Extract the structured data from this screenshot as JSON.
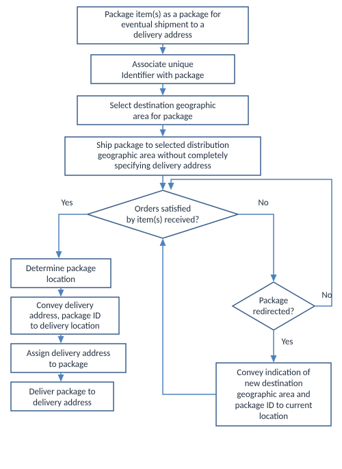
{
  "nodes": {
    "n1": {
      "l1": "Package item(s) as a package for",
      "l2": "eventual shipment to a",
      "l3": "delivery address"
    },
    "n2": {
      "l1": "Associate unique",
      "l2": "Identifier with package"
    },
    "n3": {
      "l1": "Select destination geographic",
      "l2": "area for package"
    },
    "n4": {
      "l1": "Ship package to selected distribution",
      "l2": "geographic area without completely",
      "l3": "specifying delivery address"
    },
    "d1": {
      "l1": "Orders satisfied",
      "l2": "by item(s) received?"
    },
    "d1_yes": "Yes",
    "d1_no": "No",
    "n5": {
      "l1": "Determine package",
      "l2": "location"
    },
    "n6": {
      "l1": "Convey delivery",
      "l2": "address, package ID",
      "l3": "to delivery location"
    },
    "n7": {
      "l1": "Assign delivery address",
      "l2": "to package"
    },
    "n8": {
      "l1": "Deliver package to",
      "l2": "delivery address"
    },
    "d2": {
      "l1": "Package",
      "l2": "redirected?"
    },
    "d2_yes": "Yes",
    "d2_no": "No",
    "n9": {
      "l1": "Convey indication of",
      "l2": "new destination",
      "l3": "geographic area and",
      "l4": "package ID to current",
      "l5": "location"
    }
  },
  "chart_data": {
    "type": "flowchart",
    "nodes": [
      {
        "id": "n1",
        "type": "process",
        "text": "Package item(s) as a package for eventual shipment to a delivery address"
      },
      {
        "id": "n2",
        "type": "process",
        "text": "Associate unique Identifier with package"
      },
      {
        "id": "n3",
        "type": "process",
        "text": "Select destination geographic area for package"
      },
      {
        "id": "n4",
        "type": "process",
        "text": "Ship package to selected distribution geographic area without completely specifying delivery address"
      },
      {
        "id": "d1",
        "type": "decision",
        "text": "Orders satisfied by item(s) received?"
      },
      {
        "id": "n5",
        "type": "process",
        "text": "Determine package location"
      },
      {
        "id": "n6",
        "type": "process",
        "text": "Convey delivery address, package ID to delivery location"
      },
      {
        "id": "n7",
        "type": "process",
        "text": "Assign delivery address to package"
      },
      {
        "id": "n8",
        "type": "process",
        "text": "Deliver package to delivery address"
      },
      {
        "id": "d2",
        "type": "decision",
        "text": "Package redirected?"
      },
      {
        "id": "n9",
        "type": "process",
        "text": "Convey indication of new destination geographic area and package ID to current location"
      }
    ],
    "edges": [
      {
        "from": "n1",
        "to": "n2"
      },
      {
        "from": "n2",
        "to": "n3"
      },
      {
        "from": "n3",
        "to": "n4"
      },
      {
        "from": "n4",
        "to": "d1"
      },
      {
        "from": "d1",
        "to": "n5",
        "label": "Yes"
      },
      {
        "from": "d1",
        "to": "d2",
        "label": "No"
      },
      {
        "from": "n5",
        "to": "n6"
      },
      {
        "from": "n6",
        "to": "n7"
      },
      {
        "from": "n7",
        "to": "n8"
      },
      {
        "from": "d2",
        "to": "n9",
        "label": "Yes"
      },
      {
        "from": "d2",
        "to": "d1",
        "label": "No"
      },
      {
        "from": "n9",
        "to": "d1"
      }
    ]
  }
}
